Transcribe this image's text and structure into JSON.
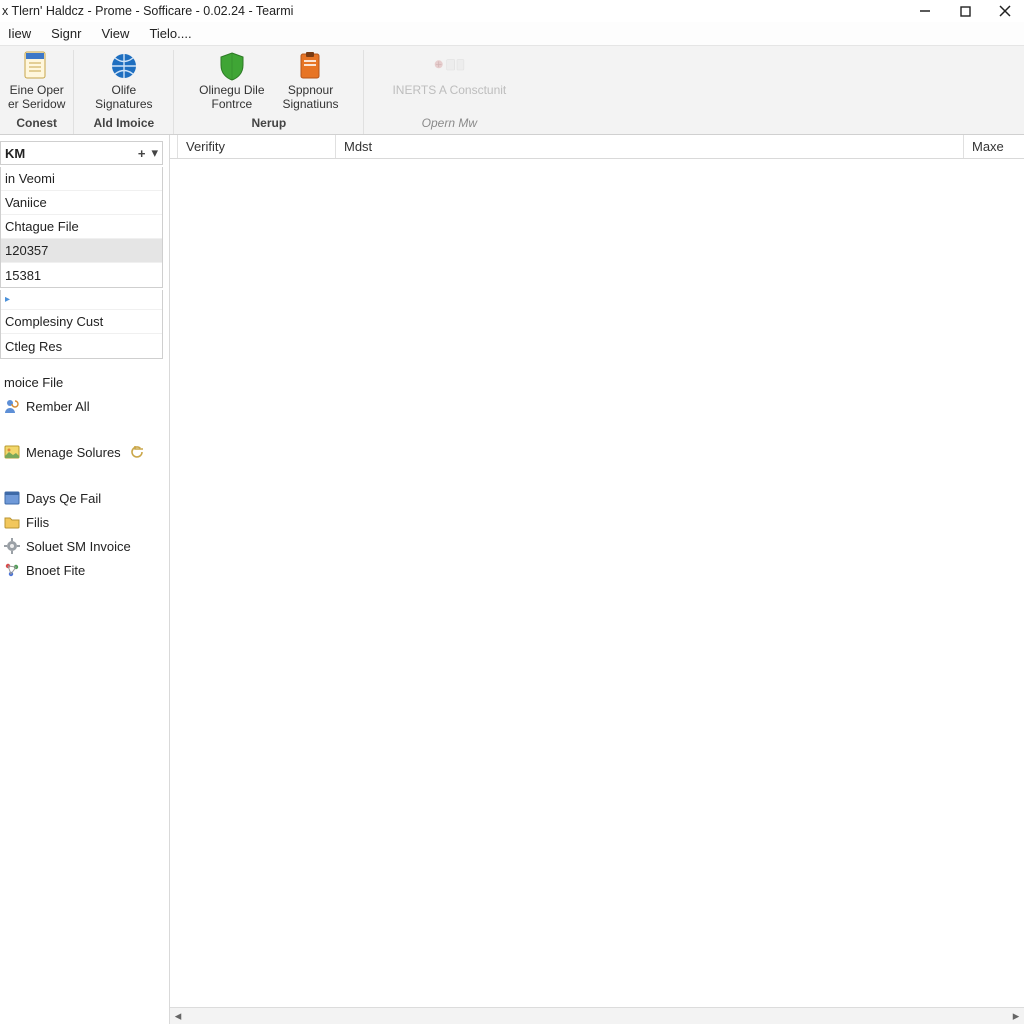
{
  "titlebar": {
    "title": "x Tlern' Haldcz - Prome - Sofficare - 0.02.24 - Tearmi"
  },
  "menubar": {
    "items": [
      "Iiew",
      "Signr",
      "View",
      "Tielo...."
    ]
  },
  "ribbon": {
    "groups": [
      {
        "label": "Conest",
        "buttons": [
          {
            "label": "Eine Oper\ner Seridow",
            "icon": "document-icon"
          }
        ]
      },
      {
        "label": "Ald Imoice",
        "buttons": [
          {
            "label": "Olife\nSignatures",
            "icon": "globe-icon"
          }
        ]
      },
      {
        "label": "Nerup",
        "buttons": [
          {
            "label": "Olinegu Dile\nFontrce",
            "icon": "shield-green-icon"
          },
          {
            "label": "Sppnour\nSignatiuns",
            "icon": "clipboard-orange-icon"
          }
        ]
      },
      {
        "label": "Opern Mw",
        "buttons": [
          {
            "label": "INERTS A Consctunit",
            "icon": "documents-disabled-icon",
            "disabled": true
          }
        ]
      }
    ]
  },
  "sidebar": {
    "selector": {
      "label": "KM"
    },
    "top_list": [
      "in Veomi",
      "Vaniice",
      "Chtague File",
      "120357",
      "15381"
    ],
    "selected_top_index": 3,
    "mid_list": [
      "Complesiny Cust",
      "Ctleg Res"
    ],
    "section_label": "moice File",
    "links": [
      {
        "label": "Rember All",
        "icon": "person-refresh-icon"
      },
      {
        "label": "Menage Solures",
        "icon": "picture-icon",
        "trailing_icon": "refresh-icon"
      },
      {
        "label": "Days Qe Fail",
        "icon": "calendar-icon"
      },
      {
        "label": "Filis",
        "icon": "folder-icon"
      },
      {
        "label": "Soluet SM Invoice",
        "icon": "gear-icon"
      },
      {
        "label": "Bnoet Fite",
        "icon": "nodes-icon"
      }
    ]
  },
  "main": {
    "columns": [
      "Verifity",
      "Mdst",
      "Maxe"
    ],
    "rows": []
  }
}
